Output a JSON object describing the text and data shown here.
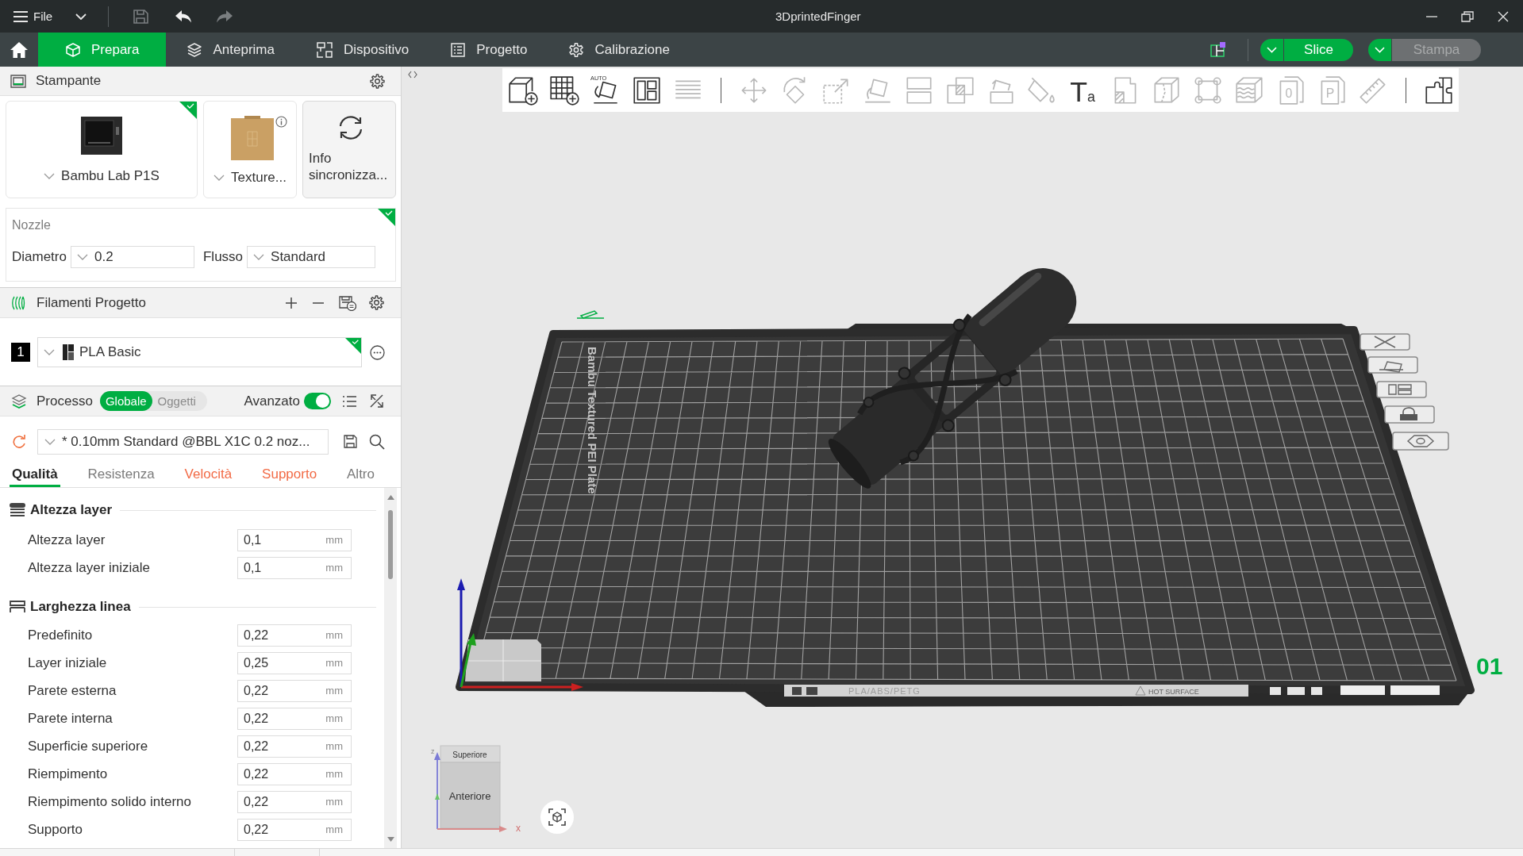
{
  "title_bar": {
    "menu": {
      "label": "File"
    },
    "actions": [
      {
        "disabled": true
      },
      {
        "disabled": false
      },
      {
        "disabled": true
      }
    ],
    "title": "3DprintedFinger"
  },
  "tabs": [
    {
      "label": "Prepara",
      "selected": true
    },
    {
      "label": "Anteprima",
      "selected": false
    },
    {
      "label": "Dispositivo",
      "selected": false
    },
    {
      "label": "Progetto",
      "selected": false
    },
    {
      "label": "Calibrazione",
      "selected": false
    }
  ],
  "slice_button": {
    "label": "Slice",
    "disabled": false
  },
  "print_button": {
    "label": "Stampa",
    "disabled": true
  },
  "printer_panel": {
    "title": "Stampante",
    "printer": {
      "name": "Bambu Lab P1S",
      "synced": true
    },
    "plate": {
      "name": "Texture..."
    },
    "sync_button": {
      "label": "Info sincronizza..."
    }
  },
  "nozzle": {
    "title": "Nozzle",
    "synced": true,
    "fields": [
      {
        "label": "Diametro",
        "value": "0.2"
      },
      {
        "label": "Flusso",
        "value": "Standard"
      }
    ]
  },
  "filaments": {
    "title": "Filamenti Progetto",
    "items": [
      {
        "number": "1",
        "name": "PLA Basic",
        "color": "#000000",
        "synced": true
      }
    ]
  },
  "process": {
    "title": "Processo",
    "scopes": [
      {
        "label": "Globale",
        "selected": true
      },
      {
        "label": "Oggetti",
        "selected": false
      }
    ],
    "advanced": {
      "label": "Avanzato",
      "on": true
    },
    "preset": {
      "value": "* 0.10mm Standard @BBL X1C 0.2 noz..."
    },
    "tabs": [
      {
        "label": "Qualità",
        "selected": true,
        "modified": false
      },
      {
        "label": "Resistenza",
        "selected": false,
        "modified": false
      },
      {
        "label": "Velocità",
        "selected": false,
        "modified": true
      },
      {
        "label": "Supporto",
        "selected": false,
        "modified": true
      },
      {
        "label": "Altro",
        "selected": false,
        "modified": false
      }
    ],
    "sections": [
      {
        "title": "Altezza layer",
        "settings": [
          {
            "label": "Altezza layer",
            "value": "0,1",
            "unit": "mm"
          },
          {
            "label": "Altezza layer iniziale",
            "value": "0,1",
            "unit": "mm"
          }
        ]
      },
      {
        "title": "Larghezza linea",
        "settings": [
          {
            "label": "Predefinito",
            "value": "0,22",
            "unit": "mm"
          },
          {
            "label": "Layer iniziale",
            "value": "0,25",
            "unit": "mm"
          },
          {
            "label": "Parete esterna",
            "value": "0,22",
            "unit": "mm"
          },
          {
            "label": "Parete interna",
            "value": "0,22",
            "unit": "mm"
          },
          {
            "label": "Superficie superiore",
            "value": "0,22",
            "unit": "mm"
          },
          {
            "label": "Riempimento",
            "value": "0,22",
            "unit": "mm"
          },
          {
            "label": "Riempimento solido interno",
            "value": "0,22",
            "unit": "mm"
          },
          {
            "label": "Supporto",
            "value": "0,22",
            "unit": "mm"
          }
        ]
      }
    ]
  },
  "toolbar": {
    "groups": [
      [
        {
          "disabled": false
        },
        {
          "disabled": false
        },
        {
          "disabled": false,
          "label": "AUTO"
        },
        {
          "disabled": false
        },
        {
          "disabled": true
        }
      ],
      [
        {
          "disabled": true
        },
        {
          "disabled": true
        },
        {
          "disabled": true
        },
        {
          "disabled": true
        },
        {
          "disabled": true
        },
        {
          "disabled": true
        },
        {
          "disabled": true
        },
        {
          "disabled": true
        },
        {
          "disabled": false,
          "label": "Ta"
        },
        {
          "disabled": true
        },
        {
          "disabled": true
        },
        {
          "disabled": true
        },
        {
          "disabled": true
        },
        {
          "disabled": true,
          "label": "0"
        },
        {
          "disabled": true,
          "label": "P"
        },
        {
          "disabled": true
        }
      ],
      [
        {
          "disabled": false
        }
      ]
    ]
  },
  "viewport": {
    "plate": {
      "label": "Bambu Textured PEI Plate",
      "strip_texts": [
        "PLA/ABS/PETG",
        "HOT SURFACE"
      ],
      "number": "01"
    },
    "view_cube": {
      "top": "Superiore",
      "front": "Anteriore",
      "axes": [
        "z",
        "x"
      ]
    }
  }
}
